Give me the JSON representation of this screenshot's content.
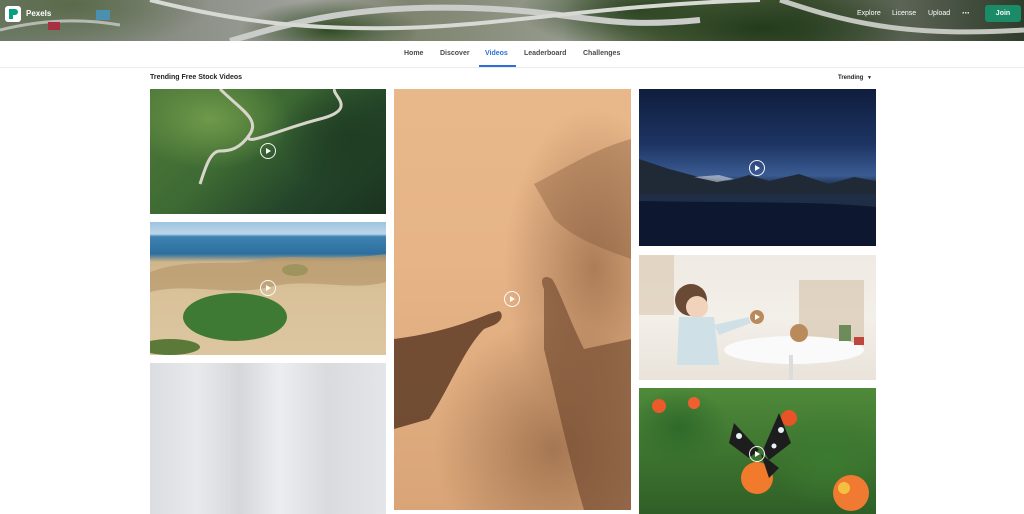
{
  "header": {
    "brand": "Pexels",
    "nav": [
      "Explore",
      "License",
      "Upload"
    ],
    "more_label": "···",
    "join_label": "Join"
  },
  "tabs": [
    {
      "label": "Home"
    },
    {
      "label": "Discover"
    },
    {
      "label": "Videos",
      "active": true
    },
    {
      "label": "Leaderboard"
    },
    {
      "label": "Challenges"
    }
  ],
  "section": {
    "title": "Trending Free Stock Videos",
    "sort_label": "Trending"
  },
  "colors": {
    "accent": "#2b6fd8",
    "join": "#1b8a67"
  }
}
